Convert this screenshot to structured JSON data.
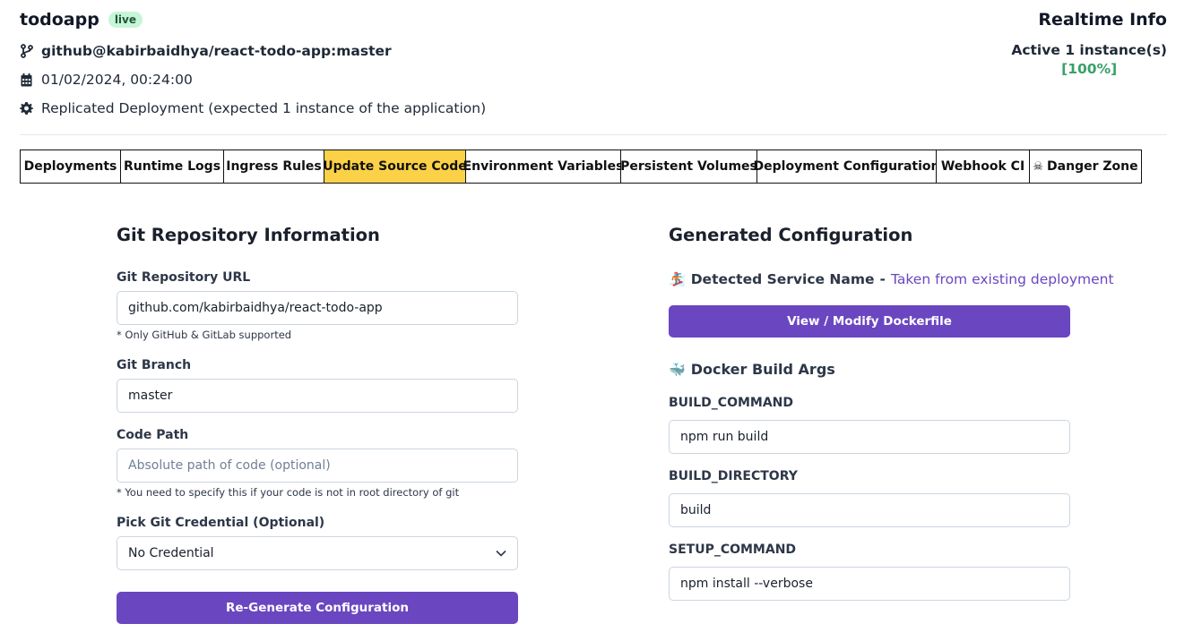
{
  "app": {
    "name": "todoapp",
    "status_badge": "live",
    "repo_ref": "github@kabirbaidhya/react-todo-app:master",
    "datetime": "01/02/2024, 00:24:00",
    "deployment_mode": "Replicated Deployment (expected 1 instance of the application)"
  },
  "realtime": {
    "title": "Realtime Info",
    "instances": "Active 1 instance(s)",
    "health": "[100%]"
  },
  "tabs": [
    {
      "label": "Deployments"
    },
    {
      "label": "Runtime Logs"
    },
    {
      "label": "Ingress Rules"
    },
    {
      "label": "Update Source Code",
      "active": true
    },
    {
      "label": "Environment Variables"
    },
    {
      "label": "Persistent Volumes"
    },
    {
      "label": "Deployment Configuration"
    },
    {
      "label": "Webhook CI"
    },
    {
      "label": "Danger Zone",
      "icon": "skull-crossbones-icon"
    }
  ],
  "git_form": {
    "title": "Git Repository Information",
    "repo_url_label": "Git Repository URL",
    "repo_url_value": "github.com/kabirbaidhya/react-todo-app",
    "repo_url_hint": "* Only GitHub & GitLab supported",
    "branch_label": "Git Branch",
    "branch_value": "master",
    "code_path_label": "Code Path",
    "code_path_placeholder": "Absolute path of code (optional)",
    "code_path_hint": "* You need to specify this if your code is not in root directory of git",
    "credential_label": "Pick Git Credential (Optional)",
    "credential_selected": "No Credential",
    "regenerate_button": "Re-Generate Configuration"
  },
  "generated": {
    "title": "Generated Configuration",
    "service_emoji": "🏂",
    "service_label": "Detected Service Name",
    "service_separator": "-",
    "service_source": "Taken from existing deployment",
    "dockerfile_button": "View / Modify Dockerfile",
    "build_args_emoji": "🐳",
    "build_args_title": "Docker Build Args",
    "args": [
      {
        "name": "BUILD_COMMAND",
        "value": "npm run build"
      },
      {
        "name": "BUILD_DIRECTORY",
        "value": "build"
      },
      {
        "name": "SETUP_COMMAND",
        "value": "npm install --verbose"
      }
    ]
  },
  "colors": {
    "accent": "#6b46c1",
    "active_tab": "#fbd147",
    "live_badge_bg": "#c6f6d5",
    "health_green": "#38a169"
  }
}
